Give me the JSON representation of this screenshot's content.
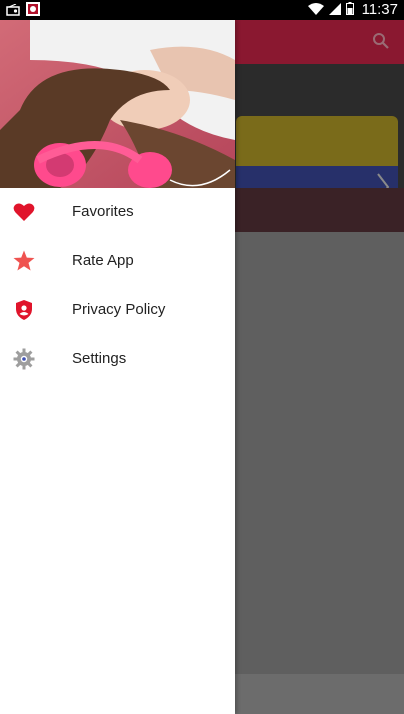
{
  "status_bar": {
    "time": "11:37",
    "icons": [
      "radio-icon",
      "app-notification-icon",
      "wifi-icon",
      "signal-icon",
      "battery-icon"
    ]
  },
  "app_bar": {
    "icons": [
      "search-icon"
    ]
  },
  "drawer": {
    "menu": [
      {
        "label": "Favorites",
        "icon": "heart-icon",
        "color": "#e0142b"
      },
      {
        "label": "Rate App",
        "icon": "star-icon",
        "color": "#ef5350"
      },
      {
        "label": "Privacy Policy",
        "icon": "shield-icon",
        "color": "#e0142b"
      },
      {
        "label": "Settings",
        "icon": "gear-icon",
        "color": "#9e9e9e"
      }
    ]
  },
  "colors": {
    "accent": "#e0142b",
    "app_bar": "#b7203f",
    "scrim": "#5f5f5f"
  }
}
